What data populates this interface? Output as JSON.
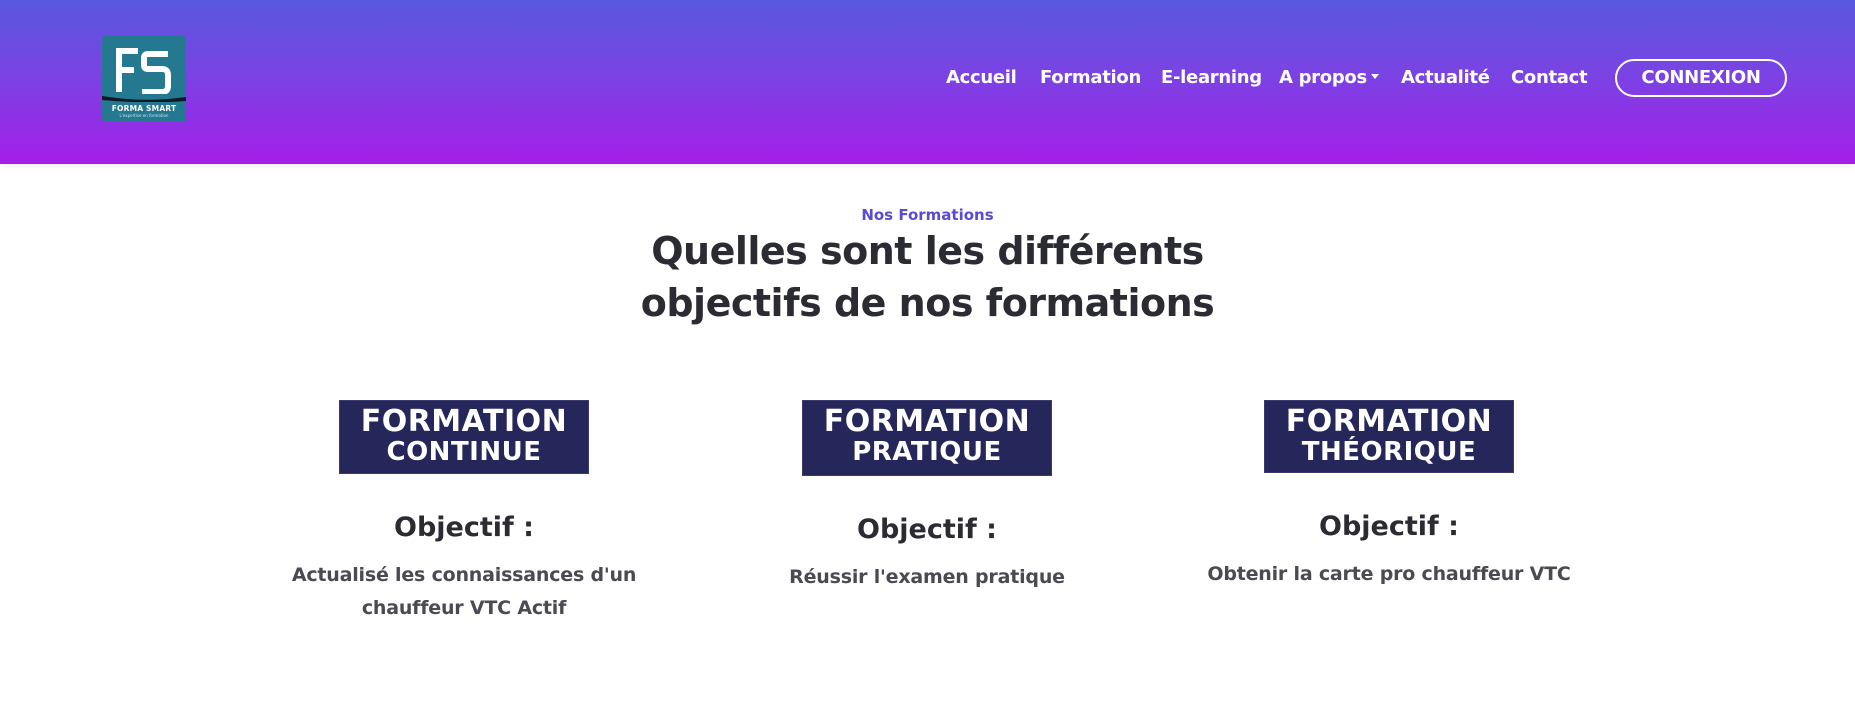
{
  "header": {
    "logo": {
      "text": "FORMA SMART",
      "subtext": "L'expertise en formation",
      "icon": "fs-monogram-icon",
      "brand_color": "#24788f"
    },
    "gradient": [
      "#5858de",
      "#a41ee8"
    ]
  },
  "nav": {
    "items": [
      {
        "label": "Accueil"
      },
      {
        "label": "Formation"
      },
      {
        "label": "E-learning"
      },
      {
        "label": "A propos",
        "has_dropdown": true
      },
      {
        "label": "Actualité"
      },
      {
        "label": "Contact"
      }
    ],
    "cta_label": "CONNEXION"
  },
  "section": {
    "eyebrow": "Nos Formations",
    "title_line1": "Quelles sont les différents",
    "title_line2": "objectifs de nos formations",
    "accent_color": "#5a4bd0"
  },
  "cards": [
    {
      "badge_line1": "FORMATION",
      "badge_line2": "CONTINUE",
      "objective_title": "Objectif :",
      "objective_line1": "Actualisé les connaissances d'un",
      "objective_line2": "chauffeur VTC Actif"
    },
    {
      "badge_line1": "FORMATION",
      "badge_line2": "PRATIQUE",
      "objective_title": "Objectif :",
      "objective_line1": "Réussir l'examen pratique",
      "objective_line2": ""
    },
    {
      "badge_line1": "FORMATION",
      "badge_line2": "THÉORIQUE",
      "objective_title": "Objectif :",
      "objective_line1": "Obtenir la carte pro chauffeur VTC",
      "objective_line2": ""
    }
  ],
  "badge_color": "#252659"
}
